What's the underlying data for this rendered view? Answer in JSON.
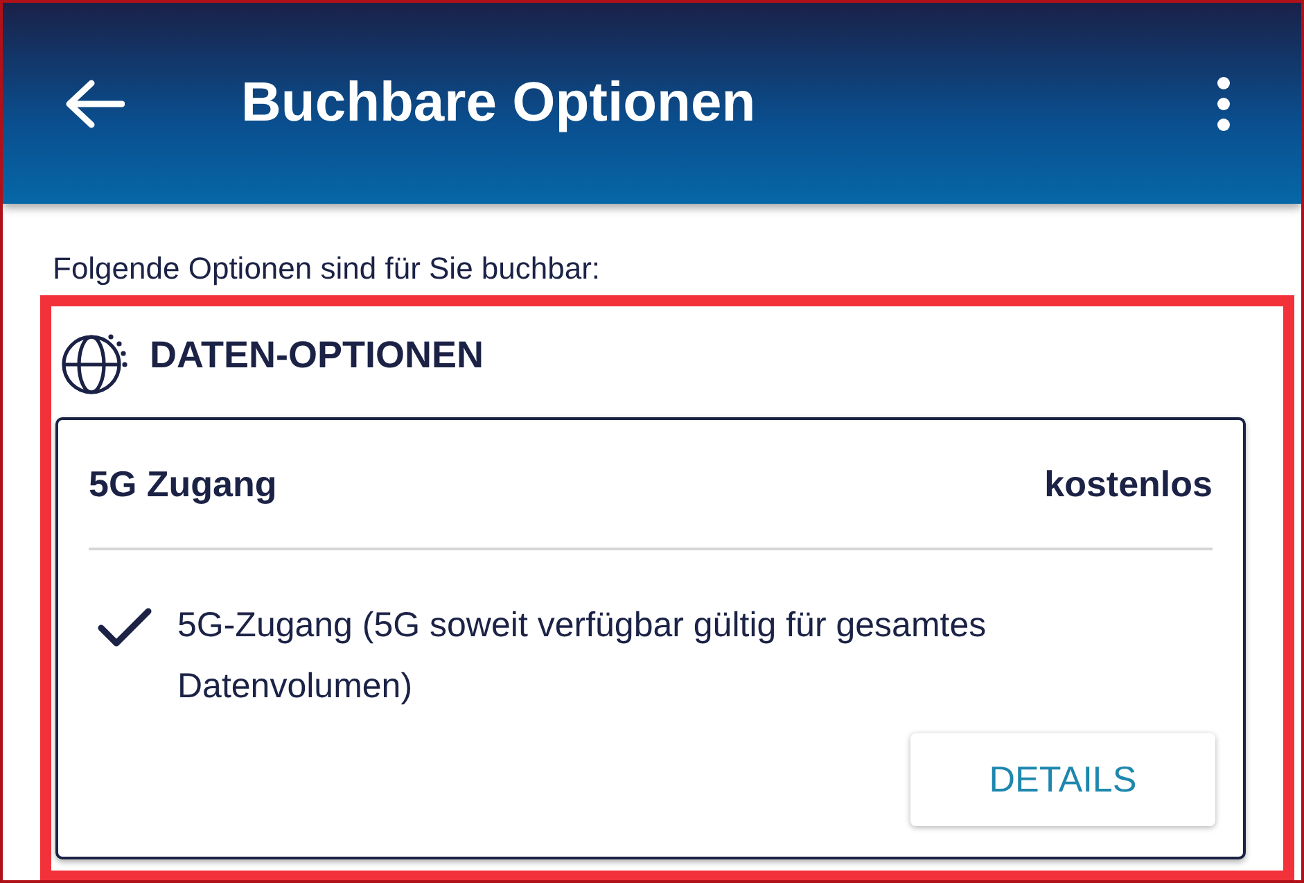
{
  "app_bar": {
    "title": "Buchbare Optionen"
  },
  "intro": "Folgende Optionen sind für Sie buchbar:",
  "sections": [
    {
      "title": "DATEN-OPTIONEN",
      "options": [
        {
          "name": "5G Zugang",
          "price": "kostenlos",
          "features": [
            "5G-Zugang (5G soweit verfügbar gültig für gesamtes Datenvolumen)"
          ],
          "button": "DETAILS"
        }
      ]
    }
  ]
}
